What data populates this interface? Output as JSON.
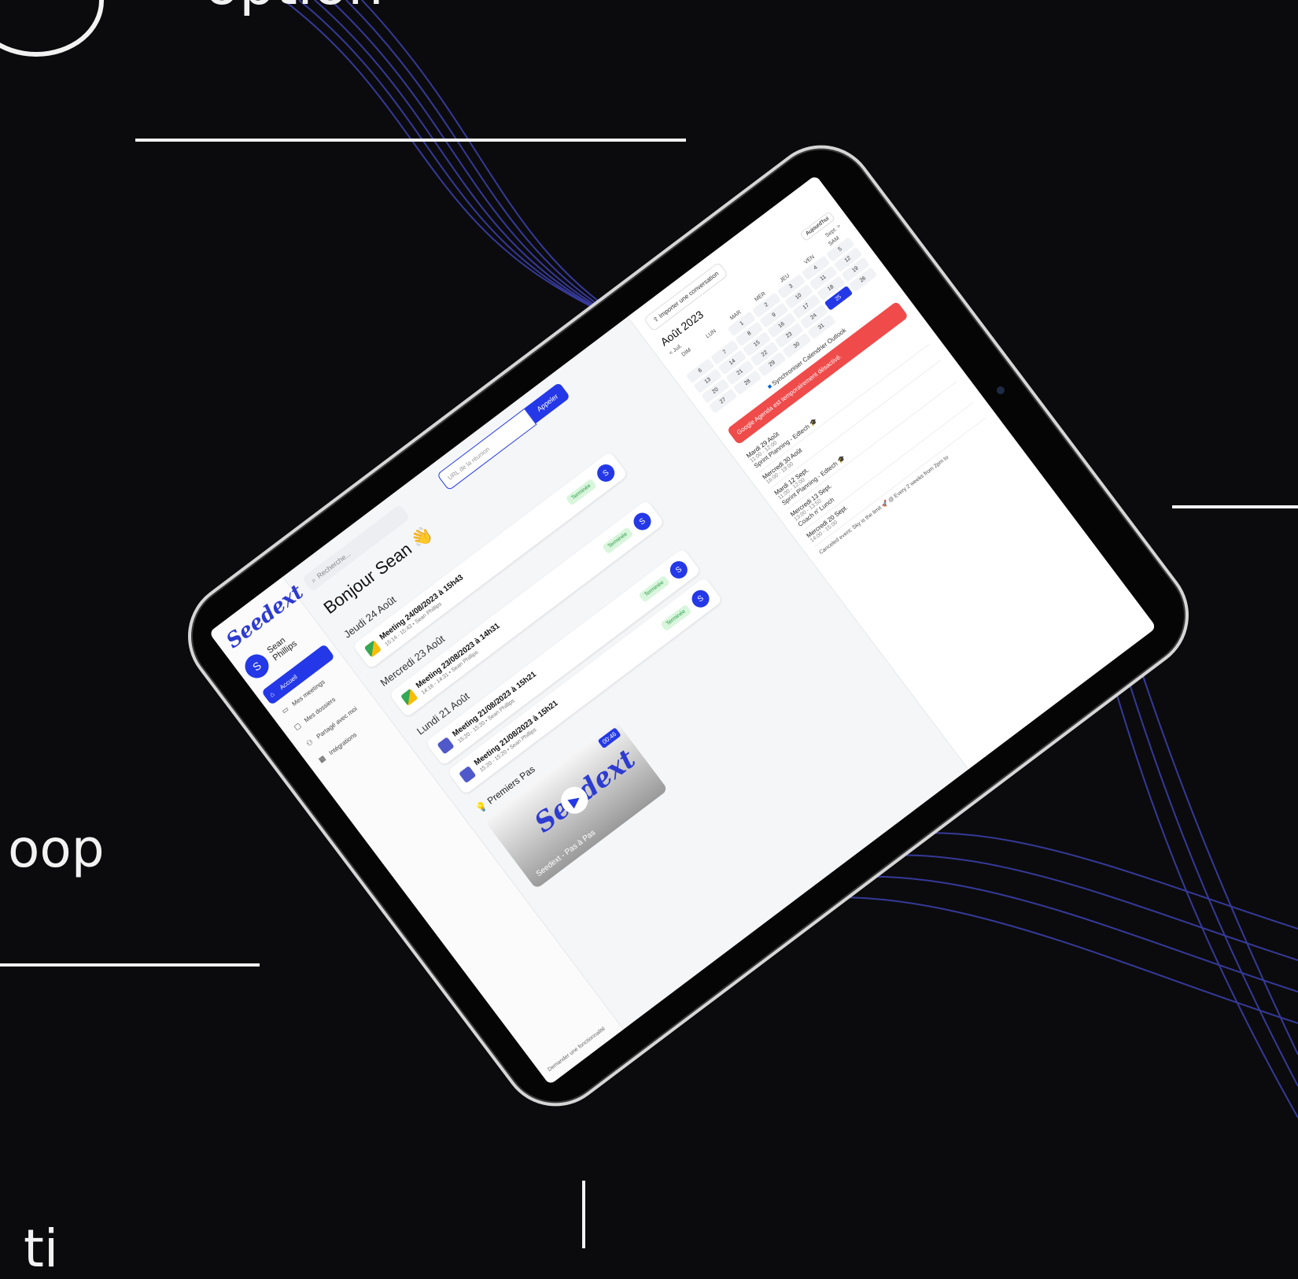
{
  "background": {
    "partial_word_top": "option",
    "partial_word_mid": "oop",
    "partial_word_bottom": "ti",
    "colors": {
      "bg": "#0b0b0d",
      "wave": "#3b3fa8",
      "text": "#f2f2f2"
    }
  },
  "app": {
    "logo": "Seedext",
    "user": {
      "initial": "S",
      "name": "Sean Phillips"
    },
    "nav": [
      {
        "label": "Accueil",
        "icon": "home-icon",
        "active": true
      },
      {
        "label": "Mes meetings",
        "icon": "video-icon"
      },
      {
        "label": "Mes dossiers",
        "icon": "folder-icon"
      },
      {
        "label": "Partagé avec moi",
        "icon": "users-icon"
      },
      {
        "label": "Intégrations",
        "icon": "grid-icon"
      }
    ],
    "feedback": "Demander une fonctionnalité",
    "search_placeholder": "Recherche...",
    "url_placeholder": "URL de la réunion",
    "url_button": "Appeler",
    "greeting": "Bonjour Sean 👋",
    "days": [
      {
        "label": "Jeudi 24 Août",
        "meetings": [
          {
            "title": "Meeting 24/08/2023 à 15h43",
            "sub": "15:14 - 15:43 • Sean Phillips",
            "status": "Terminée",
            "avatar": "S",
            "icon": "google-meet-icon"
          }
        ]
      },
      {
        "label": "Mercredi 23 Août",
        "meetings": [
          {
            "title": "Meeting 23/08/2023 à 14h31",
            "sub": "14:16 - 14:31 • Sean Phillips",
            "status": "Terminée",
            "avatar": "S",
            "icon": "google-meet-icon"
          }
        ]
      },
      {
        "label": "Lundi 21 Août",
        "meetings": [
          {
            "title": "Meeting 21/08/2023 à 15h21",
            "sub": "15:20 - 15:20 • Sean Phillips",
            "status": "Terminée",
            "avatar": "S",
            "icon": "teams-icon"
          },
          {
            "title": "Meeting 21/08/2023 à 15h21",
            "sub": "15:20 - 15:20 • Sean Phillips",
            "status": "Terminée",
            "avatar": "S",
            "icon": "teams-icon"
          }
        ]
      }
    ],
    "first_steps": "Premiers Pas",
    "video": {
      "logo": "Seedext",
      "duration": "00:46",
      "caption": "Seedext - Pas à Pas"
    },
    "import_button": "Importer une conversation",
    "calendar": {
      "title": "Août 2023",
      "today": "Aujourd'hui",
      "prev": "< Juil.",
      "next": "Sept. >",
      "dow": [
        "DIM",
        "LUN",
        "MAR",
        "MER",
        "JEU",
        "VEN",
        "SAM"
      ],
      "weeks": [
        [
          "",
          "",
          "1",
          "2",
          "3",
          "4",
          "5"
        ],
        [
          "6",
          "7",
          "8",
          "9",
          "10",
          "11",
          "12"
        ],
        [
          "13",
          "14",
          "15",
          "16",
          "17",
          "18",
          "19"
        ],
        [
          "20",
          "21",
          "22",
          "23",
          "24",
          "25",
          "26"
        ],
        [
          "27",
          "28",
          "29",
          "30",
          "31",
          "",
          ""
        ]
      ],
      "selected": "25"
    },
    "sync": "Synchroniser Calendrier Outlook",
    "alert": "Google Agenda est temporairement désactivé.",
    "events": [
      {
        "day": "Mardi 29 Août",
        "time": "11:00 - 12:00",
        "title": "Sprint Planning - Edtech 🎓"
      },
      {
        "day": "Mercredi 30 Août",
        "time": "16:00 - 19:00",
        "title": ""
      },
      {
        "day": "Mardi 12 Sept.",
        "time": "11:00 - 12:00",
        "title": "Sprint Planning - Edtech 🎓"
      },
      {
        "day": "Mercredi 13 Sept.",
        "time": "13:00 - 13:50",
        "title": "Coach n' Lunch"
      },
      {
        "day": "Mercredi 20 Sept.",
        "time": "14:00 - 15:00",
        "title": ""
      }
    ],
    "cancel_text": "Canceled event: Sky is the limit 🚀 @ Every 2 weeks from 2pm to"
  }
}
